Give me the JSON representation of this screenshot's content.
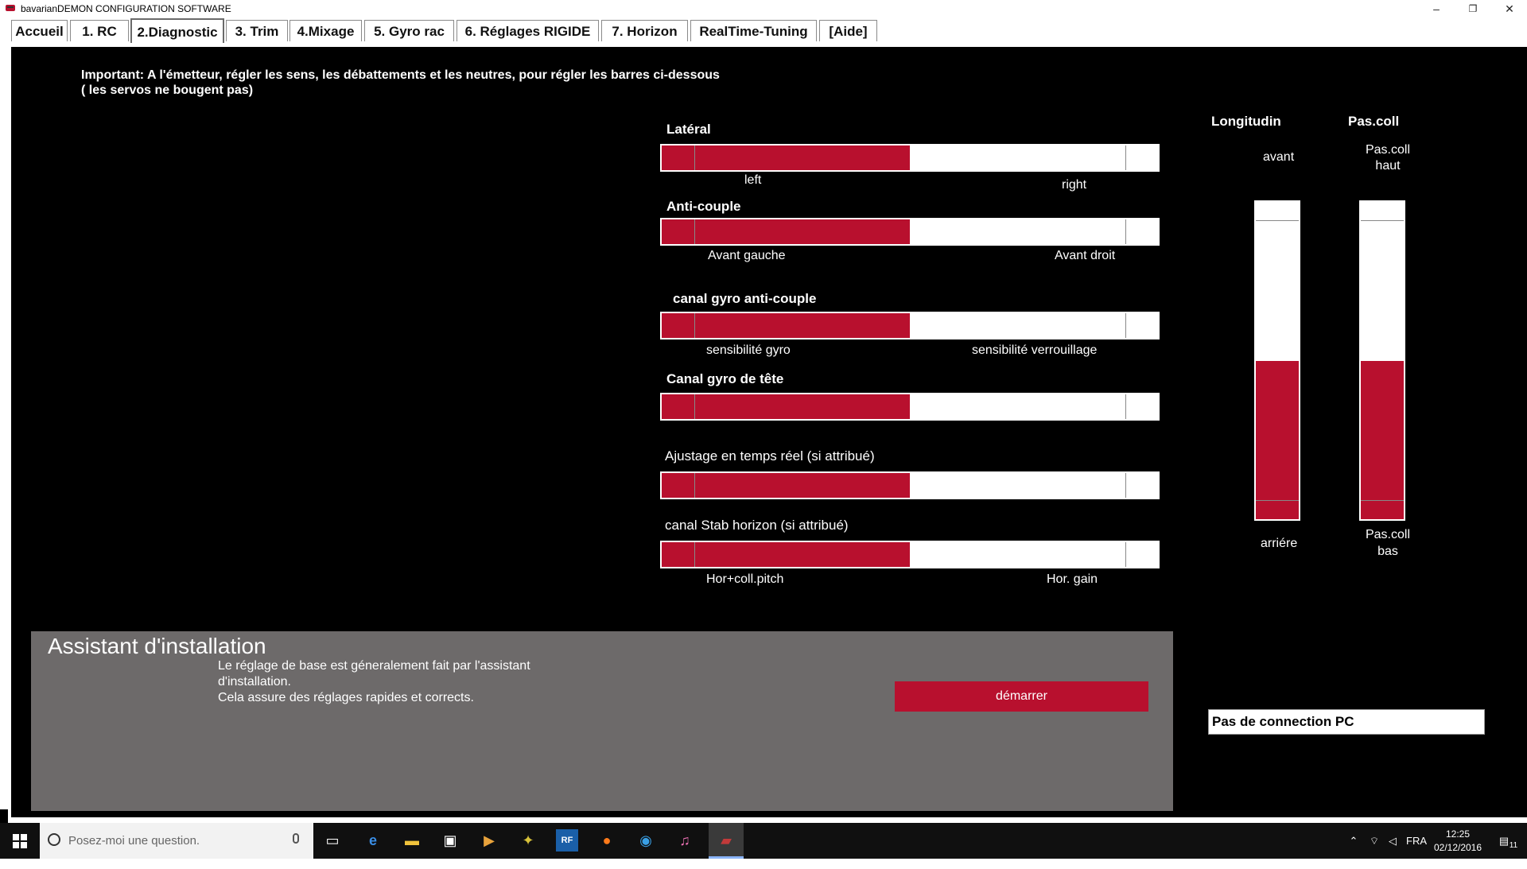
{
  "window": {
    "title": "bavarianDEMON CONFIGURATION SOFTWARE",
    "minimize": "–",
    "restore": "❐",
    "close": "✕"
  },
  "tabs": [
    {
      "label": "Accueil"
    },
    {
      "label": "1. RC"
    },
    {
      "label": "2.Diagnostic",
      "active": true
    },
    {
      "label": "3. Trim"
    },
    {
      "label": "4.Mixage"
    },
    {
      "label": "5. Gyro rac"
    },
    {
      "label": "6. Réglages RIGIDE"
    },
    {
      "label": "7. Horizon"
    },
    {
      "label": "RealTime-Tuning"
    },
    {
      "label": "[Aide]"
    }
  ],
  "notice": {
    "line1": "Important: A l'émetteur, régler les sens, les débattements et les neutres, pour régler les barres ci-dessous",
    "line2": "( les servos ne bougent pas)"
  },
  "channels": [
    {
      "title": "Latéral",
      "left_label": "left",
      "right_label": "right",
      "level": 0.5
    },
    {
      "title": "Anti-couple",
      "left_label": "Avant gauche",
      "right_label": "Avant droit",
      "level": 0.5
    },
    {
      "title": "canal gyro anti-couple",
      "left_label": "sensibilité gyro",
      "right_label": "sensibilité verrouillage",
      "level": 0.5
    },
    {
      "title": "Canal gyro de tête",
      "left_label": "",
      "right_label": "",
      "level": 0.5
    },
    {
      "title": "Ajustage en temps réel (si attribué)",
      "left_label": "",
      "right_label": "",
      "level": 0.5
    },
    {
      "title": "canal Stab horizon (si attribué)",
      "left_label": "Hor+coll.pitch",
      "right_label": "Hor. gain",
      "level": 0.5
    }
  ],
  "vertical": {
    "longitudinal": {
      "title": "Longitudin",
      "top_label": "avant",
      "bottom_label": "arriére",
      "level": 0.5
    },
    "pascoll": {
      "title": "Pas.coll",
      "top_line1": "Pas.coll",
      "top_line2": "haut",
      "bottom_line1": "Pas.coll",
      "bottom_line2": "bas",
      "level": 0.5
    }
  },
  "assistant": {
    "title": "Assistant d'installation",
    "line1": "Le réglage de base est géneralement fait par l'assistant",
    "line2": "d'installation.",
    "line3": "Cela assure des réglages rapides et corrects.",
    "button": "démarrer"
  },
  "status": "Pas de connection PC",
  "taskbar": {
    "search_placeholder": "Posez-moi une question.",
    "lang": "FRA",
    "time": "12:25",
    "date": "02/12/2016",
    "notifications": "11"
  },
  "colors": {
    "accent": "#b8102e",
    "panel": "#6d6a6a",
    "background": "#000000"
  }
}
